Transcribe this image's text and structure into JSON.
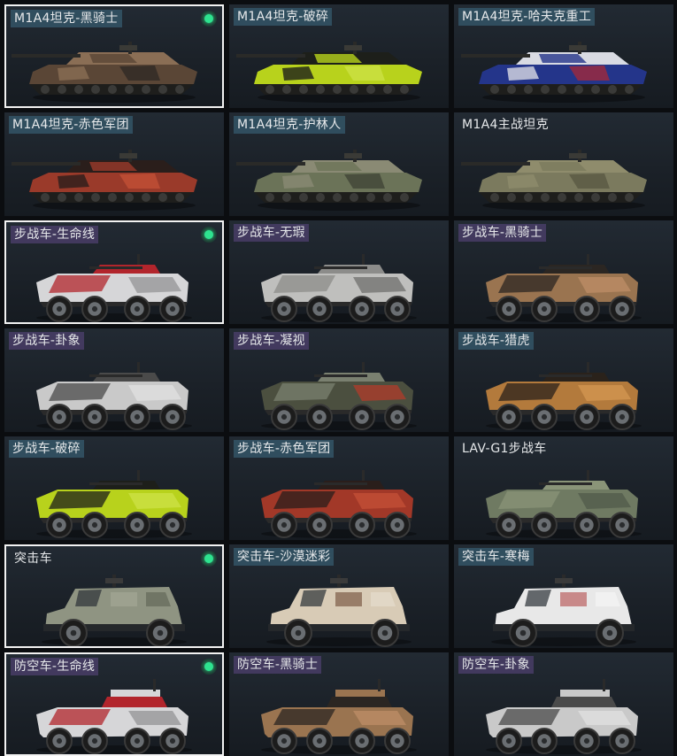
{
  "cards": [
    {
      "name": "M1A4坦克-黑骑士",
      "type": "tank",
      "tag": "blue",
      "equipped": true,
      "camo": [
        "#5a4636",
        "#8a6e55",
        "#2a2522"
      ]
    },
    {
      "name": "M1A4坦克-破碎",
      "type": "tank",
      "tag": "blue",
      "equipped": false,
      "camo": [
        "#b8d21c",
        "#1d1f1a",
        "#cfe24a"
      ]
    },
    {
      "name": "M1A4坦克-哈夫克重工",
      "type": "tank",
      "tag": "blue",
      "equipped": false,
      "camo": [
        "#24358a",
        "#d9dbe3",
        "#b22830"
      ]
    },
    {
      "name": "M1A4坦克-赤色军团",
      "type": "tank",
      "tag": "blue",
      "equipped": false,
      "camo": [
        "#9a3a2a",
        "#2a1e1b",
        "#c85238"
      ]
    },
    {
      "name": "M1A4坦克-护林人",
      "type": "tank",
      "tag": "blue",
      "equipped": false,
      "camo": [
        "#6b7358",
        "#8a8a74",
        "#3a3f32"
      ]
    },
    {
      "name": "M1A4主战坦克",
      "type": "tank",
      "tag": "none",
      "equipped": false,
      "camo": [
        "#7b7a5e",
        "#8f8c6c",
        "#55543f"
      ]
    },
    {
      "name": "步战车-生命线",
      "type": "ifv",
      "tag": "purple",
      "equipped": true,
      "camo": [
        "#d6d6d8",
        "#b2252c",
        "#8e8e92"
      ]
    },
    {
      "name": "步战车-无瑕",
      "type": "ifv",
      "tag": "purple",
      "equipped": false,
      "camo": [
        "#bfbfbd",
        "#8c8c8a",
        "#6a6a68"
      ]
    },
    {
      "name": "步战车-黑骑士",
      "type": "ifv",
      "tag": "purple",
      "equipped": false,
      "camo": [
        "#9a7450",
        "#2b2622",
        "#c09068"
      ]
    },
    {
      "name": "步战车-卦象",
      "type": "ifv",
      "tag": "purple",
      "equipped": false,
      "camo": [
        "#c9c9c9",
        "#4a4a4a",
        "#e2e2e2"
      ]
    },
    {
      "name": "步战车-凝视",
      "type": "ifv",
      "tag": "purple",
      "equipped": false,
      "camo": [
        "#4b4f3f",
        "#7a8070",
        "#b83a2a"
      ]
    },
    {
      "name": "步战车-猎虎",
      "type": "ifv",
      "tag": "blue",
      "equipped": false,
      "camo": [
        "#b37a3c",
        "#2a221b",
        "#d79a52"
      ]
    },
    {
      "name": "步战车-破碎",
      "type": "ifv",
      "tag": "blue",
      "equipped": false,
      "camo": [
        "#b8d21c",
        "#1d1f1a",
        "#cfe24a"
      ]
    },
    {
      "name": "步战车-赤色军团",
      "type": "ifv",
      "tag": "blue",
      "equipped": false,
      "camo": [
        "#a23828",
        "#2a1e1b",
        "#c85238"
      ]
    },
    {
      "name": "LAV-G1步战车",
      "type": "ifv",
      "tag": "none",
      "equipped": false,
      "camo": [
        "#6f7a62",
        "#8a9478",
        "#4f5848"
      ]
    },
    {
      "name": "突击车",
      "type": "assault",
      "tag": "none",
      "equipped": true,
      "camo": [
        "#8f9482",
        "#a6aa98",
        "#5c6052"
      ]
    },
    {
      "name": "突击车-沙漠迷彩",
      "type": "assault",
      "tag": "blue",
      "equipped": false,
      "camo": [
        "#d8cbb6",
        "#6e4a34",
        "#e8e0d0"
      ]
    },
    {
      "name": "突击车-寒梅",
      "type": "assault",
      "tag": "blue",
      "equipped": false,
      "camo": [
        "#e8e8e8",
        "#b24a4a",
        "#f6f6f6"
      ]
    },
    {
      "name": "防空车-生命线",
      "type": "aa",
      "tag": "purple",
      "equipped": true,
      "camo": [
        "#d6d6d8",
        "#b2252c",
        "#8e8e92"
      ]
    },
    {
      "name": "防空车-黑骑士",
      "type": "aa",
      "tag": "purple",
      "equipped": false,
      "camo": [
        "#9a7450",
        "#2b2622",
        "#c09068"
      ]
    },
    {
      "name": "防空车-卦象",
      "type": "aa",
      "tag": "purple",
      "equipped": false,
      "camo": [
        "#c9c9c9",
        "#4a4a4a",
        "#e2e2e2"
      ]
    }
  ]
}
